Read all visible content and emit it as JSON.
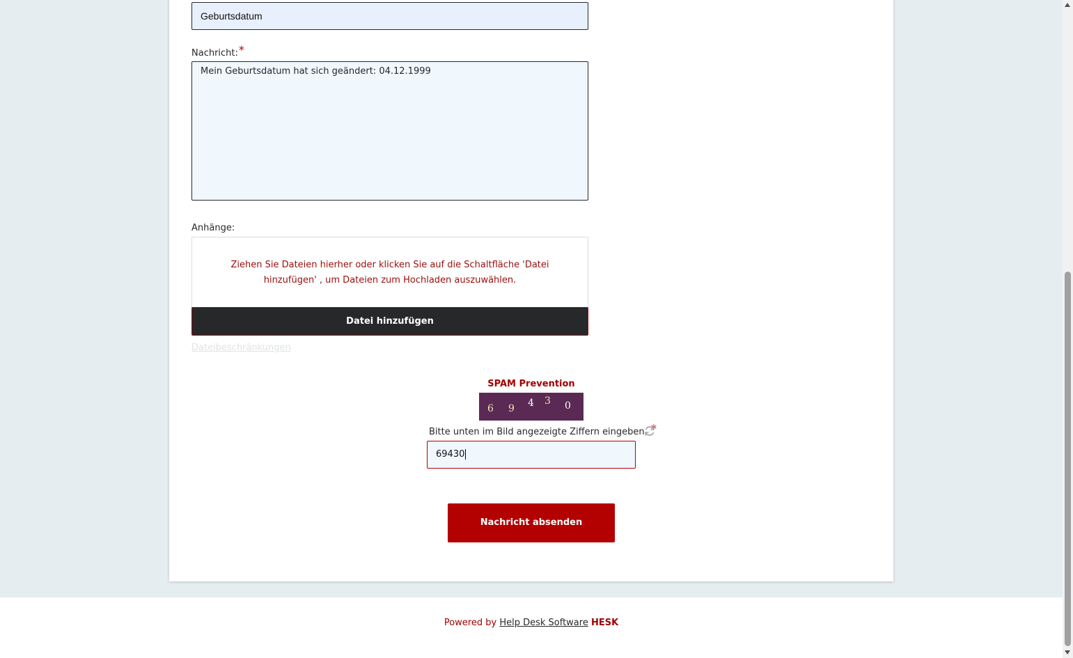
{
  "form": {
    "subject_value": "Geburtsdatum",
    "message_label": "Nachricht:",
    "required_mark": "*",
    "message_value": "Mein Geburtsdatum hat sich geändert: 04.12.1999",
    "attachments_label": "Anhänge:",
    "dropzone_text": "Ziehen Sie Dateien hierher oder klicken Sie auf die Schaltfläche 'Datei hinzufügen' , um Dateien zum Hochladen auszuwählen.",
    "add_file_label": "Datei hinzufügen",
    "restrictions_link": "Dateibeschränkungen"
  },
  "spam": {
    "title": "SPAM Prevention",
    "captcha_digits": [
      "6",
      "9",
      "4",
      "3",
      "0"
    ],
    "captcha_colors": [
      "#f3e6a8",
      "#f3e6a8",
      "#ffffff",
      "#f3e6a8",
      "#ffffff"
    ],
    "captcha_bg": "#5a2a55",
    "instruction": "Bitte unten im Bild angezeigte Ziffern eingeben.",
    "refresh_icon": "refresh-icon",
    "input_value": "69430"
  },
  "submit_label": "Nachricht absenden",
  "footer": {
    "powered_by": "Powered by",
    "link_text": "Help Desk Software",
    "brand": "HESK"
  },
  "colors": {
    "accent": "#b30000",
    "dark_button": "#26282a",
    "page_bg": "#e6edf1"
  }
}
